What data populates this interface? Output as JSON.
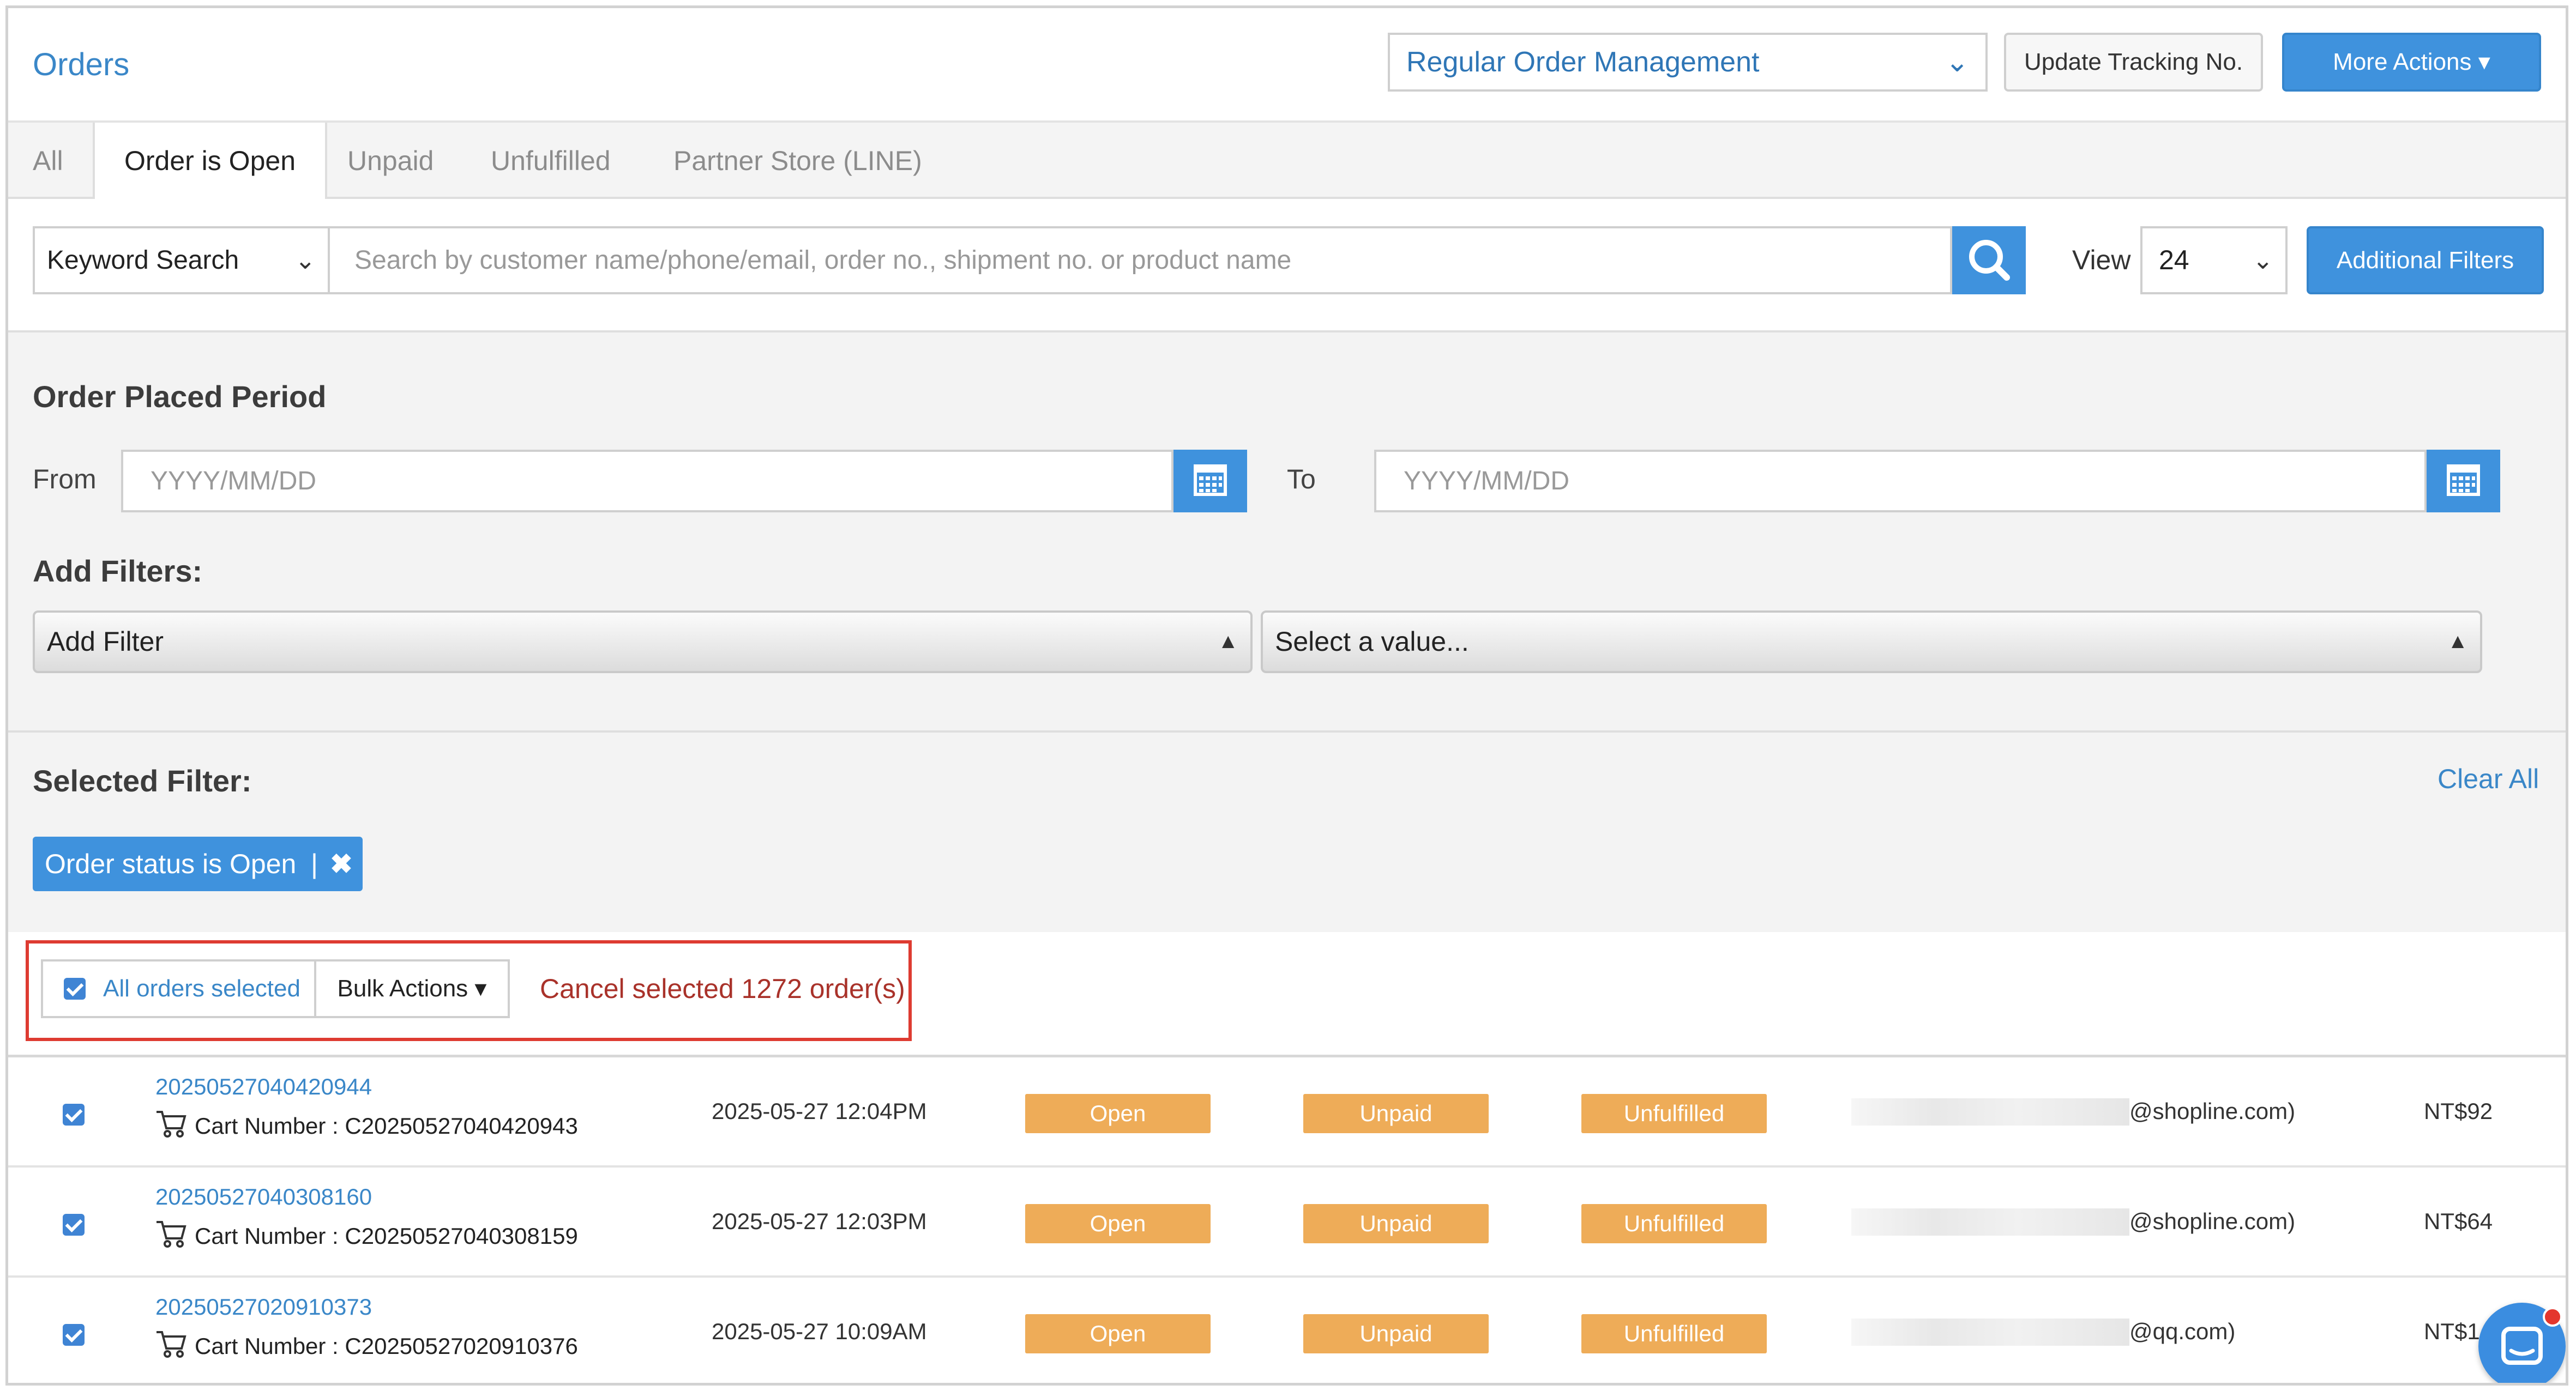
{
  "header": {
    "title": "Orders",
    "management_select": "Regular Order Management",
    "update_tracking_label": "Update Tracking No.",
    "more_actions_label": "More Actions ▾"
  },
  "tabs": [
    {
      "label": "All"
    },
    {
      "label": "Order is Open",
      "active": true
    },
    {
      "label": "Unpaid"
    },
    {
      "label": "Unfulfilled"
    },
    {
      "label": "Partner Store (LINE)"
    }
  ],
  "search": {
    "type_select": "Keyword Search",
    "placeholder": "Search by customer name/phone/email, order no., shipment no. or product name",
    "view_label": "View",
    "view_value": "24",
    "additional_filters_label": "Additional Filters"
  },
  "filters": {
    "period_heading": "Order Placed Period",
    "from_label": "From",
    "from_placeholder": "YYYY/MM/DD",
    "to_label": "To",
    "to_placeholder": "YYYY/MM/DD",
    "add_filters_heading": "Add Filters:",
    "add_filter_select": "Add Filter",
    "value_select": "Select a value...",
    "selected_heading": "Selected Filter:",
    "clear_all_label": "Clear All",
    "chip_label": "Order status is Open",
    "chip_separator": "|"
  },
  "selection": {
    "all_selected_label": "All orders selected",
    "bulk_actions_label": "Bulk Actions ▾",
    "cancel_text": "Cancel selected 1272 order(s)"
  },
  "orders": [
    {
      "order_no": "20250527040420944",
      "cart_label": "Cart Number : C20250527040420943",
      "date": "2025-05-27 12:04PM",
      "order_status": "Open",
      "payment_status": "Unpaid",
      "delivery_status": "Unfulfilled",
      "email": "@shopline.com)",
      "total": "NT$92"
    },
    {
      "order_no": "20250527040308160",
      "cart_label": "Cart Number : C20250527040308159",
      "date": "2025-05-27 12:03PM",
      "order_status": "Open",
      "payment_status": "Unpaid",
      "delivery_status": "Unfulfilled",
      "email": "@shopline.com)",
      "total": "NT$64"
    },
    {
      "order_no": "20250527020910373",
      "cart_label": "Cart Number : C20250527020910376",
      "date": "2025-05-27 10:09AM",
      "order_status": "Open",
      "payment_status": "Unpaid",
      "delivery_status": "Unfulfilled",
      "email": "@qq.com)",
      "total": "NT$1"
    }
  ],
  "colors": {
    "accent": "#3f92dd",
    "link": "#3a87c8",
    "status_badge": "#eeac58",
    "alert_border": "#de3b31",
    "cancel_text": "#a9322a"
  },
  "icons": [
    "chevron-down-icon",
    "search-icon",
    "calendar-icon",
    "close-icon",
    "checkbox-checked-icon",
    "cart-icon",
    "chat-icon"
  ]
}
